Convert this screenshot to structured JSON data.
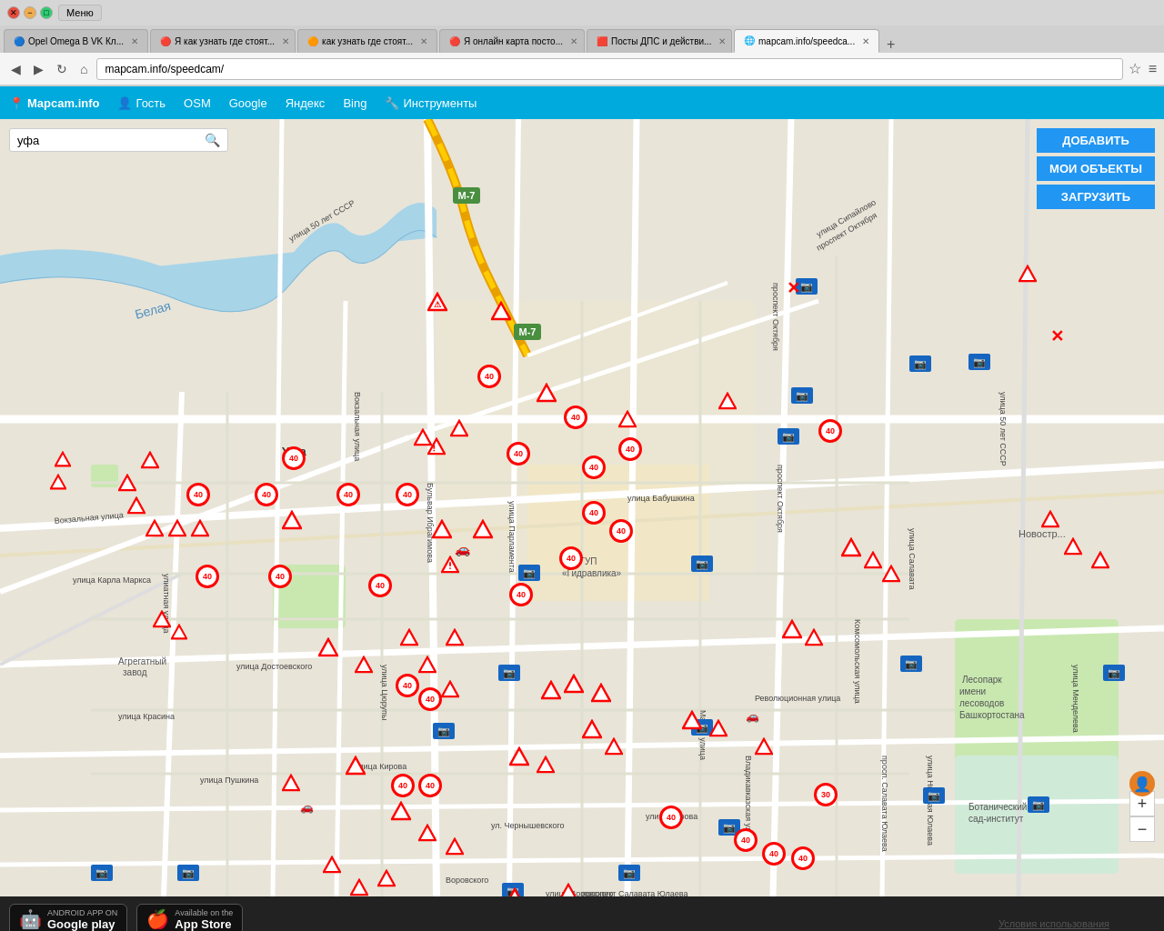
{
  "browser": {
    "title_bar": {
      "menu_label": "Меню",
      "controls": [
        "close",
        "minimize",
        "maximize"
      ]
    },
    "tabs": [
      {
        "label": "Opel Omega B VK Кл...",
        "icon": "🔵",
        "active": false,
        "closable": true
      },
      {
        "label": "Я как узнать где стоят...",
        "icon": "🔴",
        "active": false,
        "closable": true
      },
      {
        "label": "как узнать где стоят...",
        "icon": "🟠",
        "active": false,
        "closable": true
      },
      {
        "label": "Я онлайн карта посто...",
        "icon": "🔴",
        "active": false,
        "closable": true
      },
      {
        "label": "Посты ДПС и действи...",
        "icon": "🟥",
        "active": false,
        "closable": true
      },
      {
        "label": "mapcam.info/speedca...",
        "icon": "🌐",
        "active": true,
        "closable": true
      }
    ],
    "address_bar": {
      "url": "mapcam.info/speedcam/",
      "placeholder": "mapcam.info/speedcam/"
    }
  },
  "app_menubar": {
    "brand": "Mapcam.info",
    "items": [
      "Гость",
      "OSM",
      "Google",
      "Яндекс",
      "Bing",
      "Инструменты"
    ]
  },
  "search": {
    "placeholder": "уфа",
    "value": "уфа"
  },
  "action_buttons": {
    "add": "ДОБАВИТЬ",
    "my_objects": "МОИ ОБЪЕКТЫ",
    "load": "ЗАГРУЗИТЬ"
  },
  "map": {
    "region": "Уфа",
    "highway_label": "М-7",
    "river_label": "Белая",
    "district_labels": [
      "Новостр...",
      "Агрегатный завод",
      "ФГУП «Гидравлика»",
      "Лесопарк имени лесоводов Башкортостана",
      "Ботанический сад-институт"
    ],
    "street_labels": [
      "Вокзальная улица",
      "улица Карла Маркса",
      "улица Достоевского",
      "улица Пушкина",
      "улица Кирова",
      "улица Красина",
      "Комсомольская улица",
      "улица Салавата Юлаева",
      "улица Бабушкина",
      "Революционная улица",
      "улица Воровского"
    ]
  },
  "bottom_bar": {
    "google_play": {
      "small_text": "ANDROID APP ON",
      "large_text": "Google play"
    },
    "app_store": {
      "small_text": "Available on the",
      "large_text": "App Store"
    },
    "terms": "Условия использования"
  },
  "zoom_controls": {
    "in": "+",
    "out": "−"
  },
  "icons": {
    "search": "🔍",
    "person": "👤",
    "camera": "📷",
    "warning": "⚠"
  }
}
